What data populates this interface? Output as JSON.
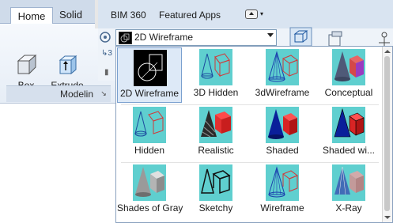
{
  "left_panel": {
    "tabs": [
      "Home",
      "Solid"
    ],
    "buttons": [
      {
        "label": "Box",
        "icon": "box-icon"
      },
      {
        "label": "Extrude",
        "icon": "extrude-icon"
      }
    ],
    "panel_title": "Modelin"
  },
  "top_tabs": [
    "BIM 360",
    "Featured Apps"
  ],
  "visual_style_combo": {
    "value": "2D Wireframe"
  },
  "styles": [
    {
      "label": "2D Wireframe",
      "selected": true,
      "icon": "2d-wireframe-icon"
    },
    {
      "label": "3D Hidden",
      "selected": false,
      "icon": "3d-hidden-icon"
    },
    {
      "label": "3dWireframe",
      "selected": false,
      "icon": "3d-wireframe-icon"
    },
    {
      "label": "Conceptual",
      "selected": false,
      "icon": "conceptual-icon"
    },
    {
      "label": "Hidden",
      "selected": false,
      "icon": "hidden-icon"
    },
    {
      "label": "Realistic",
      "selected": false,
      "icon": "realistic-icon"
    },
    {
      "label": "Shaded",
      "selected": false,
      "icon": "shaded-icon"
    },
    {
      "label": "Shaded wi...",
      "selected": false,
      "icon": "shaded-with-edges-icon"
    },
    {
      "label": "Shades of Gray",
      "selected": false,
      "icon": "shades-of-gray-icon"
    },
    {
      "label": "Sketchy",
      "selected": false,
      "icon": "sketchy-icon"
    },
    {
      "label": "Wireframe",
      "selected": false,
      "icon": "wireframe-icon"
    },
    {
      "label": "X-Ray",
      "selected": false,
      "icon": "x-ray-icon"
    }
  ],
  "colors": {
    "accent": "#dde9f7",
    "thumb_bg": "#5fcfcf"
  }
}
